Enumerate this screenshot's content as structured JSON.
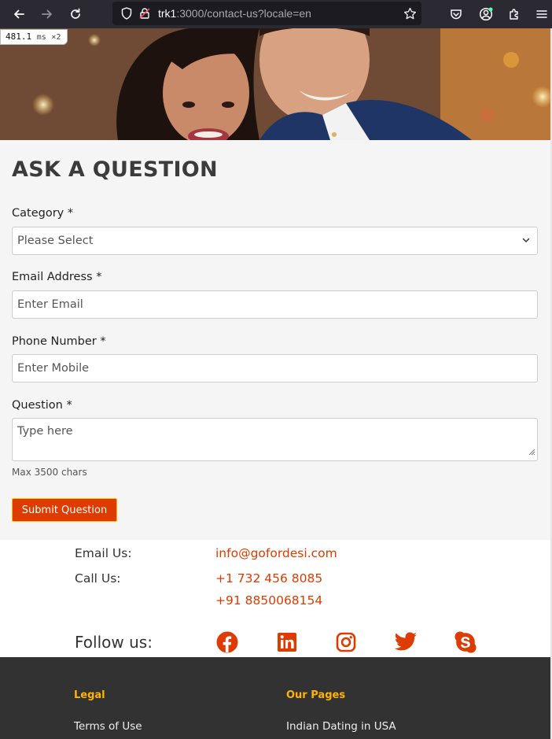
{
  "browser": {
    "url_host": "trk1",
    "url_rest": ":3000/contact-us?locale=en"
  },
  "perf": {
    "value": "481.1",
    "unit": "ms",
    "multiplier": "×2"
  },
  "form": {
    "title": "ASK A QUESTION",
    "category_label": "Category *",
    "category_value": "Please Select",
    "email_label": "Email Address *",
    "email_placeholder": "Enter Email",
    "phone_label": "Phone Number *",
    "phone_placeholder": "Enter Mobile",
    "question_label": "Question *",
    "question_placeholder": "Type here",
    "question_hint": "Max 3500 chars",
    "submit_label": "Submit Question"
  },
  "contact": {
    "email_label": "Email Us:",
    "email_value": "info@gofordesi.com",
    "call_label": "Call Us:",
    "phone_1": "+1 732 456 8085",
    "phone_2": "+91 8850068154",
    "follow_label": "Follow us:",
    "social_icons": [
      "facebook-icon",
      "linkedin-icon",
      "instagram-icon",
      "twitter-icon",
      "skype-icon"
    ]
  },
  "footer": {
    "legal_heading": "Legal",
    "legal_link_1": "Terms of Use",
    "pages_heading": "Our Pages",
    "pages_link_1": "Indian Dating in USA"
  },
  "colors": {
    "accent": "#de3b00",
    "footer_heading": "#ffb400",
    "footer_bg": "#323232",
    "browser_bar": "#2b2a33"
  }
}
